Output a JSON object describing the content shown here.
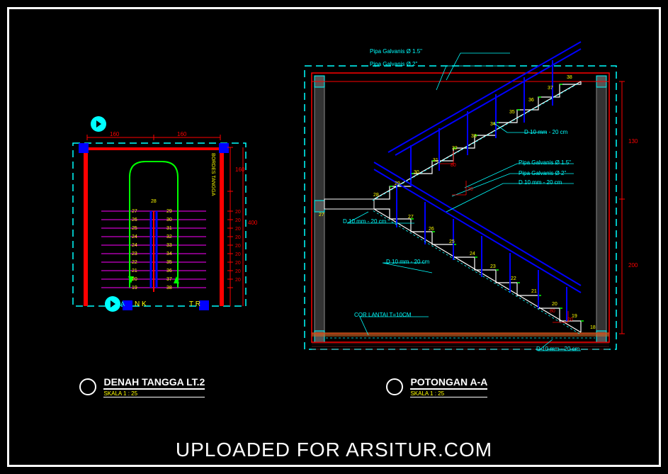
{
  "footer": "UPLOADED FOR ARSITUR.COM",
  "plan": {
    "title": "DENAH TANGGA LT.2",
    "scale": "SKALA 1 : 25",
    "dim_160_a": "160",
    "dim_160_b": "160",
    "dim_400": "400",
    "dim_160_right": "160",
    "bordes": "BORDES TANGGA",
    "nk": "N K",
    "tr": "T R",
    "risers_left": [
      "27",
      "26",
      "25",
      "24",
      "24",
      "23",
      "22",
      "21",
      "20",
      "19"
    ],
    "risers_right": [
      "29",
      "30",
      "31",
      "32",
      "33",
      "34",
      "35",
      "36",
      "37",
      "38"
    ],
    "landing_num": "28",
    "riser_dims": [
      "20",
      "20",
      "20",
      "20",
      "20",
      "20",
      "20",
      "20",
      "20"
    ]
  },
  "section": {
    "title": "POTONGAN A-A",
    "scale": "SKALA 1 : 25",
    "pipa15": "Pipa Galvanis Ø 1.5\"",
    "pipa2": "Pipa Galvanis Ø 2\"",
    "rebar": "D 10 mm - 20 cm",
    "cor": "COR LANTAI T=10CM",
    "dim_130": "130",
    "dim_200": "200",
    "run_80": "80",
    "rise_20": "20",
    "landing_27": "27",
    "stairs_lower": [
      "18",
      "19",
      "20",
      "21",
      "22",
      "23",
      "24",
      "25",
      "26",
      "27"
    ],
    "stairs_upper": [
      "28",
      "29",
      "30",
      "31",
      "32",
      "33",
      "34",
      "35",
      "36",
      "37",
      "38"
    ]
  }
}
